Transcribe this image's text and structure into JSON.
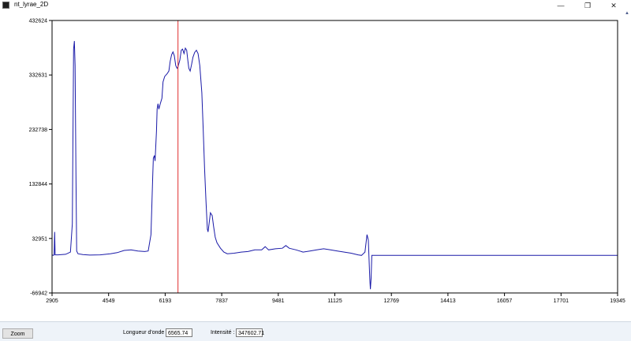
{
  "window": {
    "title": "nt_lyrae_2D",
    "minimize": "—",
    "restore": "❐",
    "close": "✕",
    "scroll_up": "▲"
  },
  "chart_data": {
    "type": "line",
    "x_ticks": [
      "2905",
      "4549",
      "6193",
      "7837",
      "9481",
      "11125",
      "12769",
      "14413",
      "16057",
      "17701",
      "19345"
    ],
    "y_ticks": [
      "432624",
      "332631",
      "232738",
      "132844",
      "32951",
      "-66942"
    ],
    "xlim": [
      2905,
      19345
    ],
    "ylim": [
      -66942,
      432624
    ],
    "cursor_x": 6565.74,
    "colors": {
      "line": "#1a1aa8",
      "cursor": "#e03030",
      "frame": "#000000"
    },
    "series": [
      {
        "points": [
          [
            2905,
            3000
          ],
          [
            2940,
            2000
          ],
          [
            2965,
            3000
          ],
          [
            2980,
            45000
          ],
          [
            2995,
            3000
          ],
          [
            3080,
            3000
          ],
          [
            3300,
            4000
          ],
          [
            3440,
            8000
          ],
          [
            3495,
            60000
          ],
          [
            3530,
            380000
          ],
          [
            3555,
            395000
          ],
          [
            3575,
            350000
          ],
          [
            3600,
            150000
          ],
          [
            3620,
            10000
          ],
          [
            3660,
            5000
          ],
          [
            3800,
            3500
          ],
          [
            4000,
            2500
          ],
          [
            4300,
            3000
          ],
          [
            4600,
            5000
          ],
          [
            4800,
            7000
          ],
          [
            5000,
            11000
          ],
          [
            5200,
            12000
          ],
          [
            5400,
            10000
          ],
          [
            5600,
            9000
          ],
          [
            5700,
            10000
          ],
          [
            5780,
            40000
          ],
          [
            5830,
            145000
          ],
          [
            5850,
            180000
          ],
          [
            5880,
            185000
          ],
          [
            5900,
            175000
          ],
          [
            5940,
            230000
          ],
          [
            5960,
            270000
          ],
          [
            5985,
            280000
          ],
          [
            6010,
            270000
          ],
          [
            6050,
            280000
          ],
          [
            6100,
            290000
          ],
          [
            6130,
            320000
          ],
          [
            6180,
            330000
          ],
          [
            6250,
            335000
          ],
          [
            6300,
            340000
          ],
          [
            6340,
            358000
          ],
          [
            6380,
            370000
          ],
          [
            6420,
            375000
          ],
          [
            6460,
            368000
          ],
          [
            6500,
            350000
          ],
          [
            6540,
            345000
          ],
          [
            6565,
            347600
          ],
          [
            6620,
            360000
          ],
          [
            6660,
            378000
          ],
          [
            6700,
            380000
          ],
          [
            6740,
            372000
          ],
          [
            6780,
            382000
          ],
          [
            6820,
            378000
          ],
          [
            6850,
            360000
          ],
          [
            6880,
            345000
          ],
          [
            6920,
            340000
          ],
          [
            6960,
            352000
          ],
          [
            7000,
            365000
          ],
          [
            7050,
            374000
          ],
          [
            7100,
            378000
          ],
          [
            7150,
            372000
          ],
          [
            7200,
            350000
          ],
          [
            7260,
            300000
          ],
          [
            7300,
            230000
          ],
          [
            7340,
            160000
          ],
          [
            7380,
            100000
          ],
          [
            7420,
            50000
          ],
          [
            7440,
            45000
          ],
          [
            7480,
            65000
          ],
          [
            7510,
            80000
          ],
          [
            7560,
            75000
          ],
          [
            7600,
            55000
          ],
          [
            7650,
            35000
          ],
          [
            7700,
            25000
          ],
          [
            7800,
            15000
          ],
          [
            7900,
            8000
          ],
          [
            8000,
            5000
          ],
          [
            8200,
            6000
          ],
          [
            8400,
            8000
          ],
          [
            8600,
            9000
          ],
          [
            8800,
            12000
          ],
          [
            9000,
            12000
          ],
          [
            9100,
            18000
          ],
          [
            9200,
            12000
          ],
          [
            9400,
            14000
          ],
          [
            9600,
            15000
          ],
          [
            9700,
            20000
          ],
          [
            9800,
            15000
          ],
          [
            10000,
            12000
          ],
          [
            10200,
            8000
          ],
          [
            10400,
            10000
          ],
          [
            10600,
            12000
          ],
          [
            10800,
            14000
          ],
          [
            11000,
            12000
          ],
          [
            11200,
            10000
          ],
          [
            11400,
            8000
          ],
          [
            11600,
            6000
          ],
          [
            11800,
            3000
          ],
          [
            11900,
            2000
          ],
          [
            12000,
            8000
          ],
          [
            12060,
            40000
          ],
          [
            12100,
            30000
          ],
          [
            12140,
            -40000
          ],
          [
            12160,
            -60000
          ],
          [
            12180,
            -40000
          ],
          [
            12200,
            2000
          ],
          [
            19345,
            2000
          ]
        ]
      }
    ]
  },
  "footer": {
    "zoom_label": "Zoom",
    "wavelength_label": "Longueur d'onde :",
    "wavelength_value": "6565.74",
    "intensity_label": "Intensité :",
    "intensity_value": "347602.71"
  }
}
